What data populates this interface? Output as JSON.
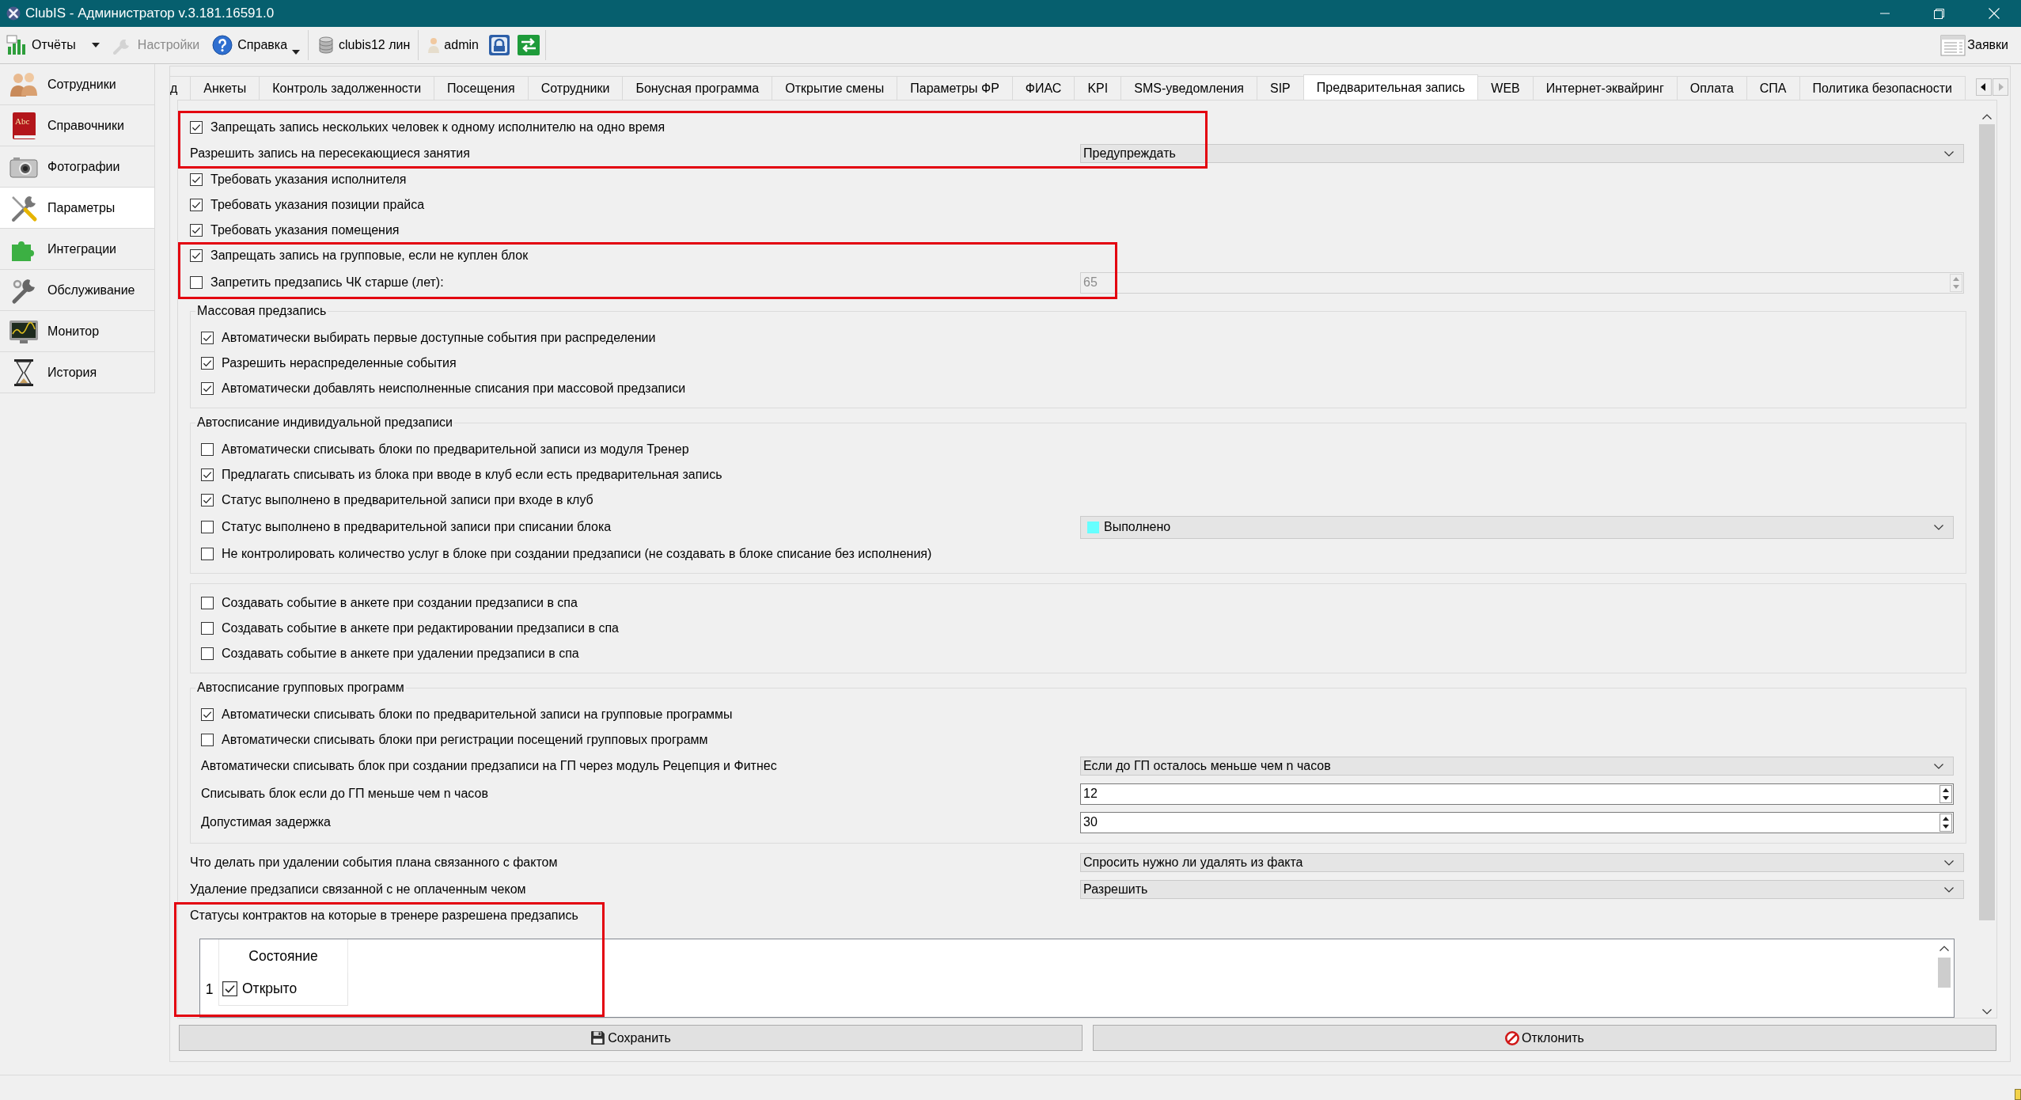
{
  "window": {
    "title": "ClubIS - Администратор v.3.181.16591.0"
  },
  "toolbar": {
    "groups": [
      {
        "items": [
          {
            "kind": "chart",
            "label": "Отчёты",
            "dropdown": true,
            "disabled": false
          },
          {
            "kind": "wrench",
            "label": "Настройки",
            "dropdown": false,
            "disabled": true
          },
          {
            "kind": "help",
            "label": "Справка",
            "dropdown": true,
            "disabled": false
          }
        ]
      },
      {
        "items": [
          {
            "kind": "database",
            "label": "clubis12 лин",
            "dropdown": false,
            "disabled": false
          }
        ]
      },
      {
        "items": [
          {
            "kind": "user",
            "label": "admin",
            "dropdown": false,
            "disabled": false
          },
          {
            "kind": "lock",
            "dropdown": false,
            "disabled": false
          },
          {
            "kind": "exchange",
            "dropdown": false,
            "disabled": false
          }
        ]
      }
    ],
    "right_item": {
      "label": "Заявки"
    }
  },
  "sidebar": {
    "items": [
      {
        "kind": "staff",
        "label": "Сотрудники",
        "selected": false
      },
      {
        "kind": "book",
        "label": "Справочники",
        "icon_text": "Abc",
        "selected": false
      },
      {
        "kind": "camera",
        "label": "Фотографии",
        "selected": false
      },
      {
        "kind": "tools",
        "label": "Параметры",
        "selected": true
      },
      {
        "kind": "puzzle",
        "label": "Интеграции",
        "selected": false
      },
      {
        "kind": "service",
        "label": "Обслуживание",
        "selected": false
      },
      {
        "kind": "monitor",
        "label": "Монитор",
        "selected": false
      },
      {
        "kind": "history",
        "label": "История",
        "selected": false
      }
    ]
  },
  "tabs": [
    {
      "label": "д",
      "selected": false
    },
    {
      "label": "Анкеты",
      "selected": false
    },
    {
      "label": "Контроль задолженности",
      "selected": false
    },
    {
      "label": "Посещения",
      "selected": false
    },
    {
      "label": "Сотрудники",
      "selected": false
    },
    {
      "label": "Бонусная программа",
      "selected": false
    },
    {
      "label": "Открытие смены",
      "selected": false
    },
    {
      "label": "Параметры ФР",
      "selected": false
    },
    {
      "label": "ФИАС",
      "selected": false
    },
    {
      "label": "KPI",
      "selected": false
    },
    {
      "label": "SMS-уведомления",
      "selected": false
    },
    {
      "label": "SIP",
      "selected": false
    },
    {
      "label": "Предварительная запись",
      "selected": true
    },
    {
      "label": "WEB",
      "selected": false
    },
    {
      "label": "Интернет-эквайринг",
      "selected": false
    },
    {
      "label": "Оплата",
      "selected": false
    },
    {
      "label": "СПА",
      "selected": false
    },
    {
      "label": "Политика безопасности",
      "selected": false
    }
  ],
  "tab_scroll_buttons": [
    {
      "kind": "left",
      "disabled": false
    },
    {
      "kind": "right",
      "disabled": true
    }
  ],
  "settings": [
    {
      "kind": "highlight",
      "rows": [
        {
          "kind": "checkbox",
          "label": "Запрещать запись нескольких человек к одному исполнителю на одно время",
          "checked": true
        },
        {
          "kind": "field",
          "label": "Разрешить запись на пересекающиеся занятия",
          "control": {
            "kind": "combo",
            "value": "Предупреждать"
          }
        }
      ]
    },
    {
      "kind": "checkbox",
      "label": "Требовать указания исполнителя",
      "checked": true
    },
    {
      "kind": "checkbox",
      "label": "Требовать указания позиции прайса",
      "checked": true
    },
    {
      "kind": "checkbox",
      "label": "Требовать указания помещения",
      "checked": true
    },
    {
      "kind": "highlight",
      "rows": [
        {
          "kind": "checkbox",
          "label": "Запрещать запись на групповые, если не куплен блок",
          "checked": true
        },
        {
          "kind": "checkbox",
          "label": "Запретить предзапись ЧК старше (лет):",
          "checked": false,
          "control": {
            "kind": "spin",
            "value": "65",
            "disabled": true
          }
        }
      ]
    },
    {
      "kind": "group",
      "title": "Массовая предзапись",
      "rows": [
        {
          "kind": "checkbox",
          "label": "Автоматически выбирать первые доступные события при распределении",
          "checked": true
        },
        {
          "kind": "checkbox",
          "label": "Разрешить нераспределенные события",
          "checked": true
        },
        {
          "kind": "checkbox",
          "label": "Автоматически добавлять неисполненные списания при массовой предзаписи",
          "checked": true
        }
      ]
    },
    {
      "kind": "group",
      "title": "Автосписание индивидуальной предзаписи",
      "rows": [
        {
          "kind": "checkbox",
          "label": "Автоматически списывать блоки по предварительной записи из модуля Тренер",
          "checked": false
        },
        {
          "kind": "checkbox",
          "label": "Предлагать списывать из блока при вводе в клуб если есть предварительная запись",
          "checked": true
        },
        {
          "kind": "checkbox",
          "label": "Статус выполнено в предварительной записи при входе в клуб",
          "checked": true
        },
        {
          "kind": "checkbox",
          "label": "Статус выполнено в предварительной записи при списании блока",
          "checked": false,
          "control": {
            "kind": "combo",
            "value": "Выполнено",
            "color": "#66ffff"
          }
        },
        {
          "kind": "checkbox",
          "label": "Не контролировать количество услуг в блоке при создании предзаписи (не создавать в блоке списание без исполнения)",
          "checked": false
        }
      ]
    },
    {
      "kind": "group",
      "rows": [
        {
          "kind": "checkbox",
          "label": "Создавать событие в анкете при создании предзаписи в спа",
          "checked": false
        },
        {
          "kind": "checkbox",
          "label": "Создавать событие в анкете при редактировании предзаписи в спа",
          "checked": false
        },
        {
          "kind": "checkbox",
          "label": "Создавать событие в анкете при удалении предзаписи в спа",
          "checked": false
        }
      ]
    },
    {
      "kind": "group",
      "title": "Автосписание групповых программ",
      "rows": [
        {
          "kind": "checkbox",
          "label": "Автоматически списывать блоки по предварительной записи на групповые программы",
          "checked": true
        },
        {
          "kind": "checkbox",
          "label": "Автоматически списывать блоки при регистрации посещений групповых программ",
          "checked": false
        },
        {
          "kind": "field",
          "label": "Автоматически списывать блок при создании предзаписи на ГП через модуль Рецепция и Фитнес",
          "control": {
            "kind": "combo",
            "value": "Если до ГП осталось меньше чем n часов"
          }
        },
        {
          "kind": "field",
          "label": "Списывать блок если до ГП меньше чем n часов",
          "control": {
            "kind": "spin",
            "value": "12",
            "disabled": false
          }
        },
        {
          "kind": "field",
          "label": "Допустимая задержка",
          "control": {
            "kind": "spin",
            "value": "30",
            "disabled": false
          }
        }
      ]
    },
    {
      "kind": "field",
      "label": "Что делать при удалении события плана связанного с фактом",
      "control": {
        "kind": "combo",
        "value": "Спросить нужно ли удалять из факта"
      }
    },
    {
      "kind": "field",
      "label": "Удаление предзаписи связанной с не оплаченным чеком",
      "control": {
        "kind": "combo",
        "value": "Разрешить"
      }
    },
    {
      "kind": "highlight",
      "rows": [
        {
          "kind": "label",
          "label": "Статусы контрактов на которые в тренере разрешена предзапись"
        },
        {
          "kind": "table",
          "columns": [
            "Состояние"
          ],
          "rows": [
            {
              "number": "1",
              "checked": true,
              "value": "Открыто"
            }
          ]
        }
      ]
    }
  ],
  "buttons": [
    {
      "kind": "save",
      "label": "Сохранить"
    },
    {
      "kind": "cancel",
      "label": "Отклонить"
    }
  ]
}
